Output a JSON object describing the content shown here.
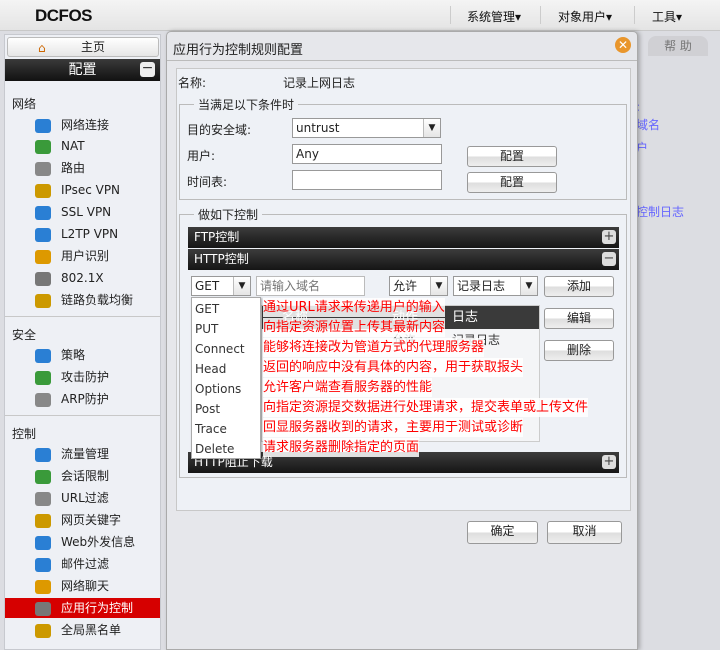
{
  "topbar": {
    "logo": "DCFOS",
    "menus": [
      "系统管理▾",
      "对象用户▾",
      "工具▾"
    ]
  },
  "sidebar": {
    "home": "主页",
    "section": "配置",
    "groups": [
      {
        "title": "网络",
        "items": [
          "网络连接",
          "NAT",
          "路由",
          "IPsec VPN",
          "SSL VPN",
          "L2TP VPN",
          "用户识别",
          "802.1X",
          "链路负载均衡"
        ]
      },
      {
        "title": "安全",
        "items": [
          "策略",
          "攻击防护",
          "ARP防护"
        ]
      },
      {
        "title": "控制",
        "items": [
          "流量管理",
          "会话限制",
          "URL过滤",
          "网页关键字",
          "Web外发信息",
          "邮件过滤",
          "网络聊天",
          "应用行为控制",
          "全局黑名单"
        ]
      }
    ],
    "selected": "应用行为控制"
  },
  "help": {
    "tab": "帮 助",
    "links": [
      ":",
      "域名",
      "户",
      "控制日志"
    ]
  },
  "dialog": {
    "title": "应用行为控制规则配置",
    "name_label": "名称:",
    "name_value": "记录上网日志",
    "conditions": {
      "legend": "当满足以下条件时",
      "zone_label": "目的安全域:",
      "zone_value": "untrust",
      "user_label": "用户:",
      "user_value": "Any",
      "schedule_label": "时间表:",
      "schedule_value": "",
      "config_button": "配置"
    },
    "actions": {
      "legend": "做如下控制",
      "ftp_bar": "FTP控制",
      "http_bar": "HTTP控制",
      "bottom_bar": "HTTP阻止下载",
      "method_value": "GET",
      "domain_placeholder": "请输入域名",
      "action_value": "允许",
      "log_value": "记录日志",
      "add": "添加",
      "edit": "编辑",
      "delete": "删除",
      "table_headers": [
        "名称",
        "动作",
        "日志"
      ],
      "table_row": [
        "",
        "允许",
        "记录日志"
      ],
      "method_options": [
        "GET",
        "PUT",
        "Connect",
        "Head",
        "Options",
        "Post",
        "Trace",
        "Delete"
      ],
      "annotations": [
        "通过URL请求来传递用户的输入",
        "向指定资源位置上传其最新内容",
        "能够将连接改为管道方式的代理服务器",
        "返回的响应中没有具体的内容，用于获取报头",
        "允许客户端查看服务器的性能",
        "向指定资源提交数据进行处理请求，提交表单或上传文件",
        "回显服务器收到的请求，主要用于测试或诊断",
        "请求服务器删除指定的页面"
      ]
    },
    "ok": "确定",
    "cancel": "取消"
  },
  "colors": {
    "accent_red": "#d60000",
    "annotation": "#ff0000",
    "bar": "#222222"
  }
}
